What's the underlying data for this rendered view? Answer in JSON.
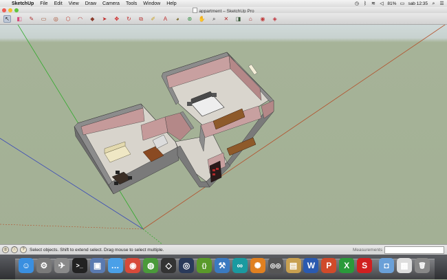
{
  "menubar": {
    "apple_glyph": "",
    "items": [
      "SketchUp",
      "File",
      "Edit",
      "View",
      "Draw",
      "Camera",
      "Tools",
      "Window",
      "Help"
    ],
    "battery": "81%",
    "clock": "sab 12:35"
  },
  "window": {
    "title": "appartment – SketchUp Pro",
    "traffic_lights": [
      "#ee5d54",
      "#f5bd2f",
      "#5fc53f"
    ]
  },
  "toolbar": {
    "tools": [
      {
        "name": "select-tool-icon",
        "glyph": "↖",
        "color": "#222222",
        "selected": true
      },
      {
        "name": "eraser-tool-icon",
        "glyph": "◧",
        "color": "#d94a7a"
      },
      {
        "name": "pencil-tool-icon",
        "glyph": "✎",
        "color": "#b03030"
      },
      {
        "name": "rectangle-tool-icon",
        "glyph": "▭",
        "color": "#9b4a2a"
      },
      {
        "name": "circle-tool-icon",
        "glyph": "◎",
        "color": "#a84a2a"
      },
      {
        "name": "polygon-tool-icon",
        "glyph": "⬡",
        "color": "#c03a2a"
      },
      {
        "name": "arc-tool-icon",
        "glyph": "◠",
        "color": "#b03838"
      },
      {
        "name": "pushpull-tool-icon",
        "glyph": "◆",
        "color": "#8a3a2a"
      },
      {
        "name": "followme-tool-icon",
        "glyph": "➤",
        "color": "#c02a2a"
      },
      {
        "name": "move-tool-icon",
        "glyph": "✥",
        "color": "#d02020"
      },
      {
        "name": "rotate-tool-icon",
        "glyph": "↻",
        "color": "#c03030"
      },
      {
        "name": "offset-tool-icon",
        "glyph": "⧉",
        "color": "#b83a3a"
      },
      {
        "name": "tape-measure-icon",
        "glyph": "✐",
        "color": "#c8a020"
      },
      {
        "name": "text-tool-icon",
        "glyph": "A",
        "color": "#c03030"
      },
      {
        "name": "paint-bucket-icon",
        "glyph": "◕",
        "color": "#7a6a2a"
      },
      {
        "name": "orbit-tool-icon",
        "glyph": "⊛",
        "color": "#2a8a3a"
      },
      {
        "name": "pan-tool-icon",
        "glyph": "✋",
        "color": "#c0302a"
      },
      {
        "name": "zoom-tool-icon",
        "glyph": "⌕",
        "color": "#333333"
      },
      {
        "name": "zoom-extents-icon",
        "glyph": "✕",
        "color": "#b02a2a"
      },
      {
        "name": "previous-view-icon",
        "glyph": "◨",
        "color": "#3a5a3a"
      },
      {
        "name": "warehouse-icon",
        "glyph": "⌂",
        "color": "#a02a2a"
      },
      {
        "name": "share-model-icon",
        "glyph": "◉",
        "color": "#c03a3a"
      },
      {
        "name": "extension-warehouse-icon",
        "glyph": "◈",
        "color": "#c0303a"
      }
    ]
  },
  "statusbar": {
    "text": "Select objects. Shift to extend select. Drag mouse to select multiple.",
    "measurements_label": "Measurements"
  },
  "dock": {
    "icons": [
      {
        "name": "finder-icon",
        "glyph": "☺",
        "color": "#3a8fe0"
      },
      {
        "name": "system-preferences-icon",
        "glyph": "⚙",
        "color": "#7a7a7a"
      },
      {
        "name": "launchpad-icon",
        "glyph": "✈",
        "color": "#8a8a8a"
      },
      {
        "name": "terminal-icon",
        "glyph": ">_",
        "color": "#222222"
      },
      {
        "name": "preview-icon",
        "glyph": "▣",
        "color": "#5a7ab0"
      },
      {
        "name": "messages-icon",
        "glyph": "…",
        "color": "#4aa0e8"
      },
      {
        "name": "chrome-icon",
        "glyph": "◉",
        "color": "#d84a3a"
      },
      {
        "name": "globe-app-icon",
        "glyph": "◍",
        "color": "#4a9a3a"
      },
      {
        "name": "unity-icon",
        "glyph": "◇",
        "color": "#333333"
      },
      {
        "name": "steam-icon",
        "glyph": "◎",
        "color": "#2a3a5a"
      },
      {
        "name": "brackets-icon",
        "glyph": "{}",
        "color": "#5a9a2a"
      },
      {
        "name": "xcode-icon",
        "glyph": "⚒",
        "color": "#3a7ac0"
      },
      {
        "name": "arduino-icon",
        "glyph": "∞",
        "color": "#1a9aa0"
      },
      {
        "name": "gear-app-icon",
        "glyph": "✺",
        "color": "#e08020"
      },
      {
        "name": "glasses-app-icon",
        "glyph": "◎◎",
        "color": "#555555"
      },
      {
        "name": "notebook-app-icon",
        "glyph": "▤",
        "color": "#c8a050"
      },
      {
        "name": "word-icon",
        "glyph": "W",
        "color": "#2a5ab0"
      },
      {
        "name": "powerpoint-icon",
        "glyph": "P",
        "color": "#d04a2a"
      },
      {
        "name": "excel-icon",
        "glyph": "X",
        "color": "#2a9a3a"
      },
      {
        "name": "sketchup-dock-icon",
        "glyph": "S",
        "color": "#d02020"
      },
      {
        "name": "downloads-folder-icon",
        "glyph": "◘",
        "color": "#6aa0d8"
      },
      {
        "name": "document-stack-icon",
        "glyph": "▦",
        "color": "#dddddd"
      },
      {
        "name": "trash-icon",
        "glyph": "🗑",
        "color": "#888888"
      }
    ]
  }
}
